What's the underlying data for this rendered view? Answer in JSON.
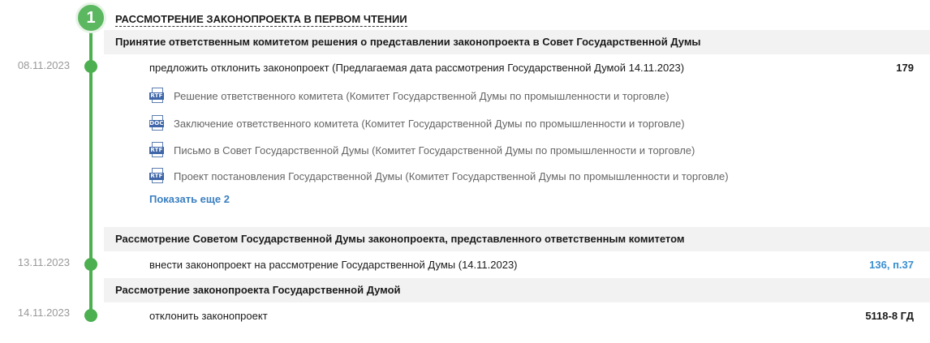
{
  "stage": {
    "number": "1",
    "title": "РАССМОТРЕНИЕ ЗАКОНОПРОЕКТА В ПЕРВОМ ЧТЕНИИ"
  },
  "events": [
    {
      "header": "Принятие ответственным комитетом решения о представлении законопроекта в Совет Государственной Думы",
      "date": "08.11.2023",
      "decision": "предложить отклонить законопроект (Предлагаемая дата рассмотрения Государственной Думой 14.11.2023)",
      "number": "179",
      "documents": [
        {
          "type": "RTF",
          "icon": "rtf-file-icon",
          "label": "Решение ответственного комитета (Комитет Государственной Думы по промышленности и торговле)"
        },
        {
          "type": "DOC",
          "icon": "doc-file-icon",
          "label": "Заключение ответственного комитета (Комитет Государственной Думы по промышленности и торговле)"
        },
        {
          "type": "RTF",
          "icon": "rtf-file-icon",
          "label": "Письмо в Совет Государственной Думы (Комитет Государственной Думы по промышленности и торговле)"
        },
        {
          "type": "RTF",
          "icon": "rtf-file-icon",
          "label": "Проект постановления Государственной Думы (Комитет Государственной Думы по промышленности и торговле)"
        }
      ],
      "show_more": "Показать еще 2"
    },
    {
      "header": "Рассмотрение Советом Государственной Думы законопроекта, представленного ответственным комитетом",
      "date": "13.11.2023",
      "decision": "внести законопроект на рассмотрение Государственной Думы (14.11.2023)",
      "number": "136, п.37"
    },
    {
      "header": "Рассмотрение законопроекта Государственной Думой",
      "date": "14.11.2023",
      "decision": "отклонить законопроект",
      "number": "5118-8 ГД"
    }
  ],
  "colors": {
    "timeline": "#4caf50",
    "header_bg": "#f2f2f2",
    "link": "#3a7fc0",
    "doc_icon": "#3e66a8"
  }
}
